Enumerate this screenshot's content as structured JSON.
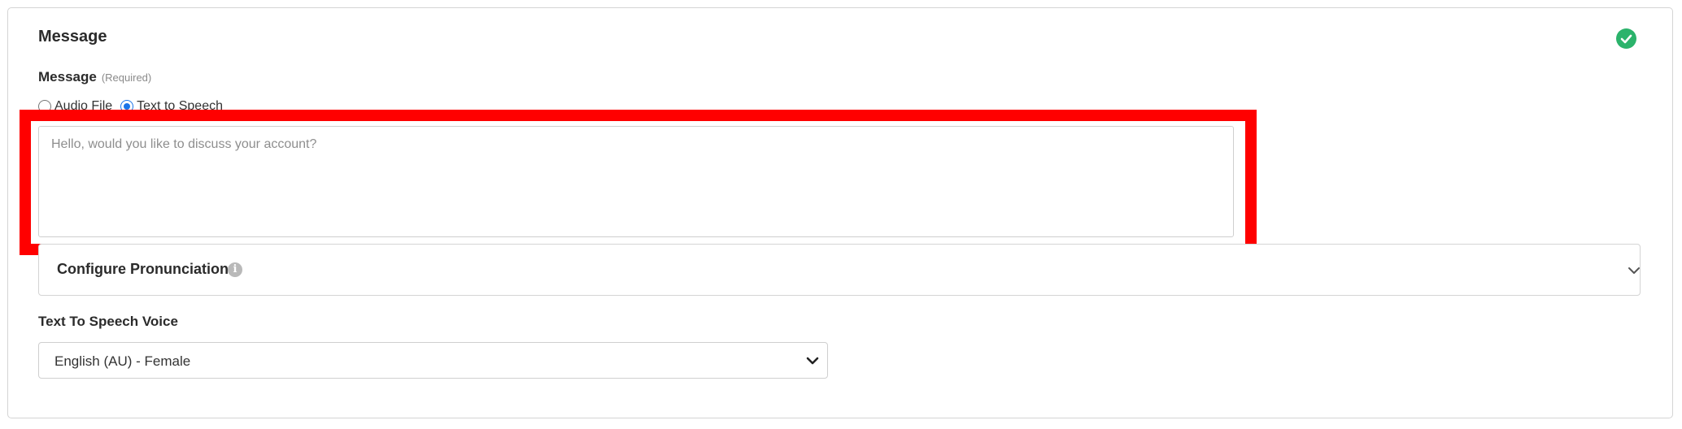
{
  "section": {
    "title": "Message",
    "status_icon": "check-circle-icon",
    "status_color": "#2bb36b"
  },
  "message_field": {
    "label": "Message",
    "required_note": "(Required)",
    "radio_options": [
      {
        "label": "Audio File",
        "checked": false
      },
      {
        "label": "Text to Speech",
        "checked": true
      }
    ],
    "value": "",
    "placeholder": "Hello, would you like to discuss your account?"
  },
  "pronunciation": {
    "title": "Configure Pronunciation",
    "info_icon": "info-icon",
    "chevron_icon": "chevron-down-icon"
  },
  "voice": {
    "label": "Text To Speech Voice",
    "selected": "English (AU) - Female",
    "chevron_icon": "chevron-down-icon"
  },
  "highlight_color": "#ff0000",
  "accent_color": "#1a73e8"
}
